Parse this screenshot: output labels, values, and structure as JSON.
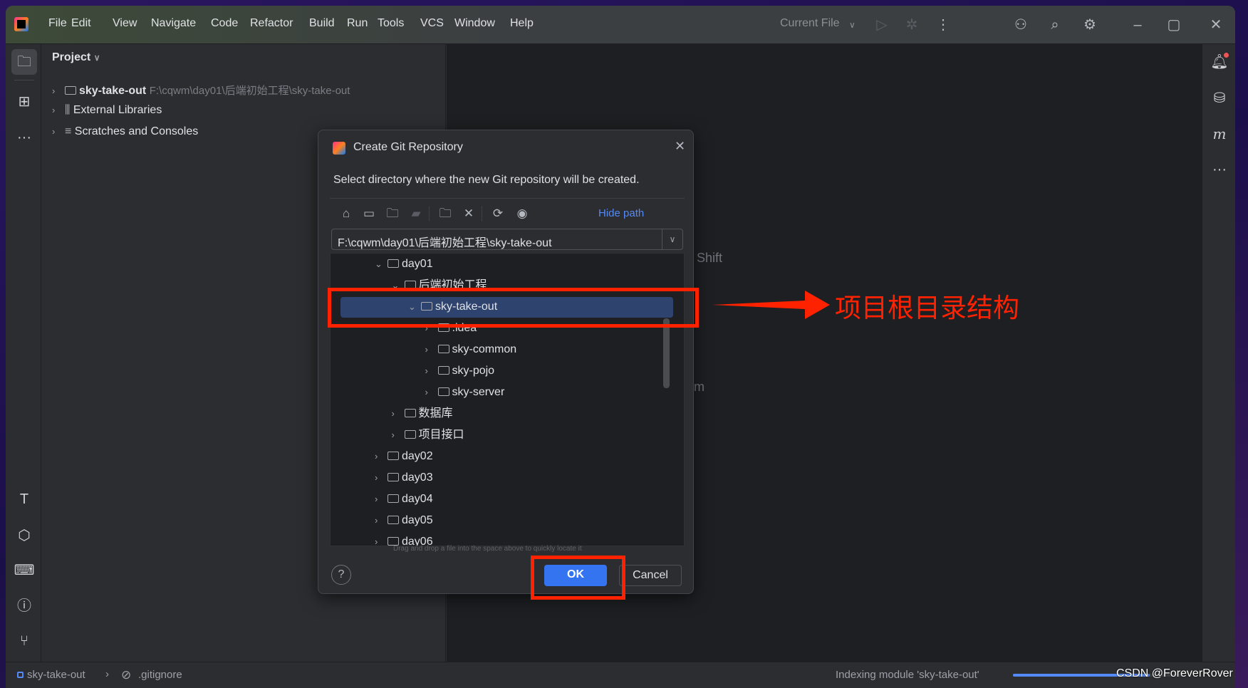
{
  "menu": [
    "File",
    "Edit",
    "View",
    "Navigate",
    "Code",
    "Refactor",
    "Build",
    "Run",
    "Tools",
    "VCS",
    "Window",
    "Help"
  ],
  "toolbar": {
    "run_config": "Current File"
  },
  "project_panel": {
    "title": "Project",
    "items": [
      {
        "label": "sky-take-out",
        "path": "F:\\cqwm\\day01\\后端初始工程\\sky-take-out"
      },
      {
        "label": "External Libraries"
      },
      {
        "label": "Scratches and Consoles"
      }
    ]
  },
  "editor_bg": {
    "hint1": "e Shift",
    "hint2": "m"
  },
  "dialog": {
    "title": "Create Git Repository",
    "description": "Select directory where the new Git repository will be created.",
    "hide_path": "Hide path",
    "path_value": "F:\\cqwm\\day01\\后端初始工程\\sky-take-out",
    "tree": [
      {
        "label": "day01",
        "level": 0,
        "expanded": true
      },
      {
        "label": "后端初始工程",
        "level": 1,
        "expanded": true
      },
      {
        "label": "sky-take-out",
        "level": 2,
        "expanded": true,
        "selected": true
      },
      {
        "label": ".idea",
        "level": 3
      },
      {
        "label": "sky-common",
        "level": 3
      },
      {
        "label": "sky-pojo",
        "level": 3
      },
      {
        "label": "sky-server",
        "level": 3
      },
      {
        "label": "数据库",
        "level": 1
      },
      {
        "label": "项目接口",
        "level": 1
      },
      {
        "label": "day02",
        "level": 0
      },
      {
        "label": "day03",
        "level": 0
      },
      {
        "label": "day04",
        "level": 0
      },
      {
        "label": "day05",
        "level": 0
      },
      {
        "label": "day06",
        "level": 0
      }
    ],
    "drag_hint": "Drag and drop a file into the space above to quickly locate it",
    "ok": "OK",
    "cancel": "Cancel",
    "help": "?"
  },
  "annotation": {
    "text": "项目根目录结构",
    "color": "#ff2200"
  },
  "statusbar": {
    "project": "sky-take-out",
    "file": ".gitignore",
    "indexing": "Indexing module 'sky-take-out'",
    "indexing_progress": 0.8
  },
  "watermark": "CSDN @ForeverRover",
  "colors": {
    "accent": "#3574f0",
    "selection": "#2e436e",
    "link": "#548af7"
  }
}
